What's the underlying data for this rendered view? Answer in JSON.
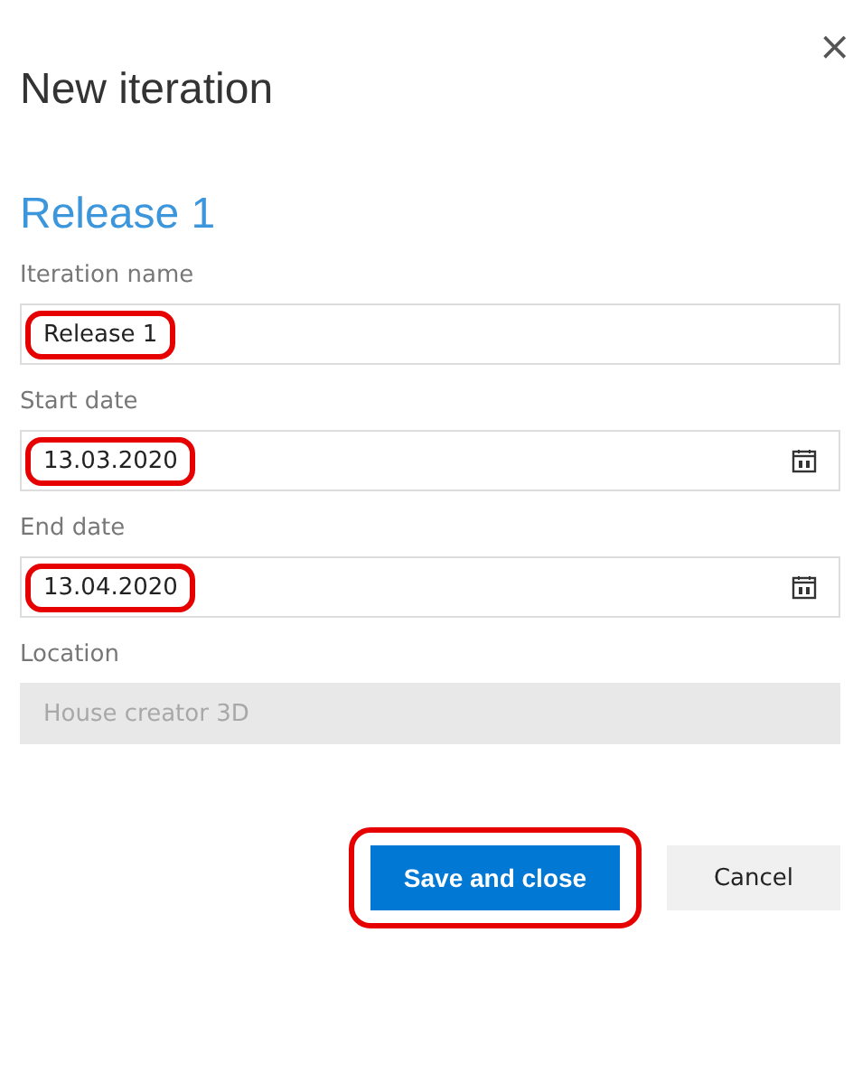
{
  "dialog": {
    "title": "New iteration",
    "close": "×"
  },
  "heading": "Release 1",
  "fields": [
    {
      "label": "Iteration name",
      "value": "Release 1",
      "kind": "text",
      "disabled": false,
      "highlighted": true
    },
    {
      "label": "Start date",
      "value": "13.03.2020",
      "kind": "date",
      "disabled": false,
      "highlighted": true
    },
    {
      "label": "End date",
      "value": "13.04.2020",
      "kind": "date",
      "disabled": false,
      "highlighted": true
    },
    {
      "label": "Location",
      "value": "House creator 3D",
      "kind": "text",
      "disabled": true,
      "highlighted": false
    }
  ],
  "buttons": [
    {
      "label": "Save and close",
      "kind": "primary",
      "highlighted": true
    },
    {
      "label": "Cancel",
      "kind": "secondary",
      "highlighted": false
    }
  ]
}
